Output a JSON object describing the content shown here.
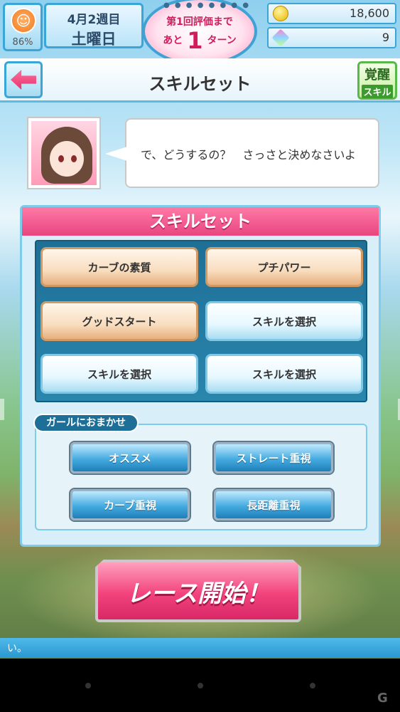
{
  "top": {
    "avatar_percent": "86%",
    "week": "4月2週目",
    "day": "土曜日",
    "eval_line1": "第1回評価まで",
    "eval_prefix": "あと",
    "eval_number": "1",
    "eval_suffix": "ターン",
    "coins": "18,600",
    "gems": "9"
  },
  "titlebar": {
    "title": "スキルセット",
    "awaken_top": "覚醒",
    "awaken_bottom": "スキル"
  },
  "dialogue": {
    "text": "で、どうするの？　さっさと決めなさいよ"
  },
  "panel": {
    "title": "スキルセット",
    "slots": [
      {
        "label": "カーブの素質",
        "state": "filled"
      },
      {
        "label": "プチパワー",
        "state": "filled"
      },
      {
        "label": "グッドスタート",
        "state": "filled"
      },
      {
        "label": "スキルを選択",
        "state": "empty"
      },
      {
        "label": "スキルを選択",
        "state": "empty"
      },
      {
        "label": "スキルを選択",
        "state": "empty"
      }
    ],
    "omakase_label": "ガールにおまかせ",
    "omakase_buttons": [
      "オススメ",
      "ストレート重視",
      "カーブ重視",
      "長距離重視"
    ]
  },
  "race_button": "レース開始！",
  "ticker": "い。",
  "watermark": "G",
  "colors": {
    "accent_pink": "#e8457f",
    "accent_blue": "#3aa6d8",
    "slot_filled": "#f8ddbf",
    "slot_empty": "#e6f8ff"
  }
}
